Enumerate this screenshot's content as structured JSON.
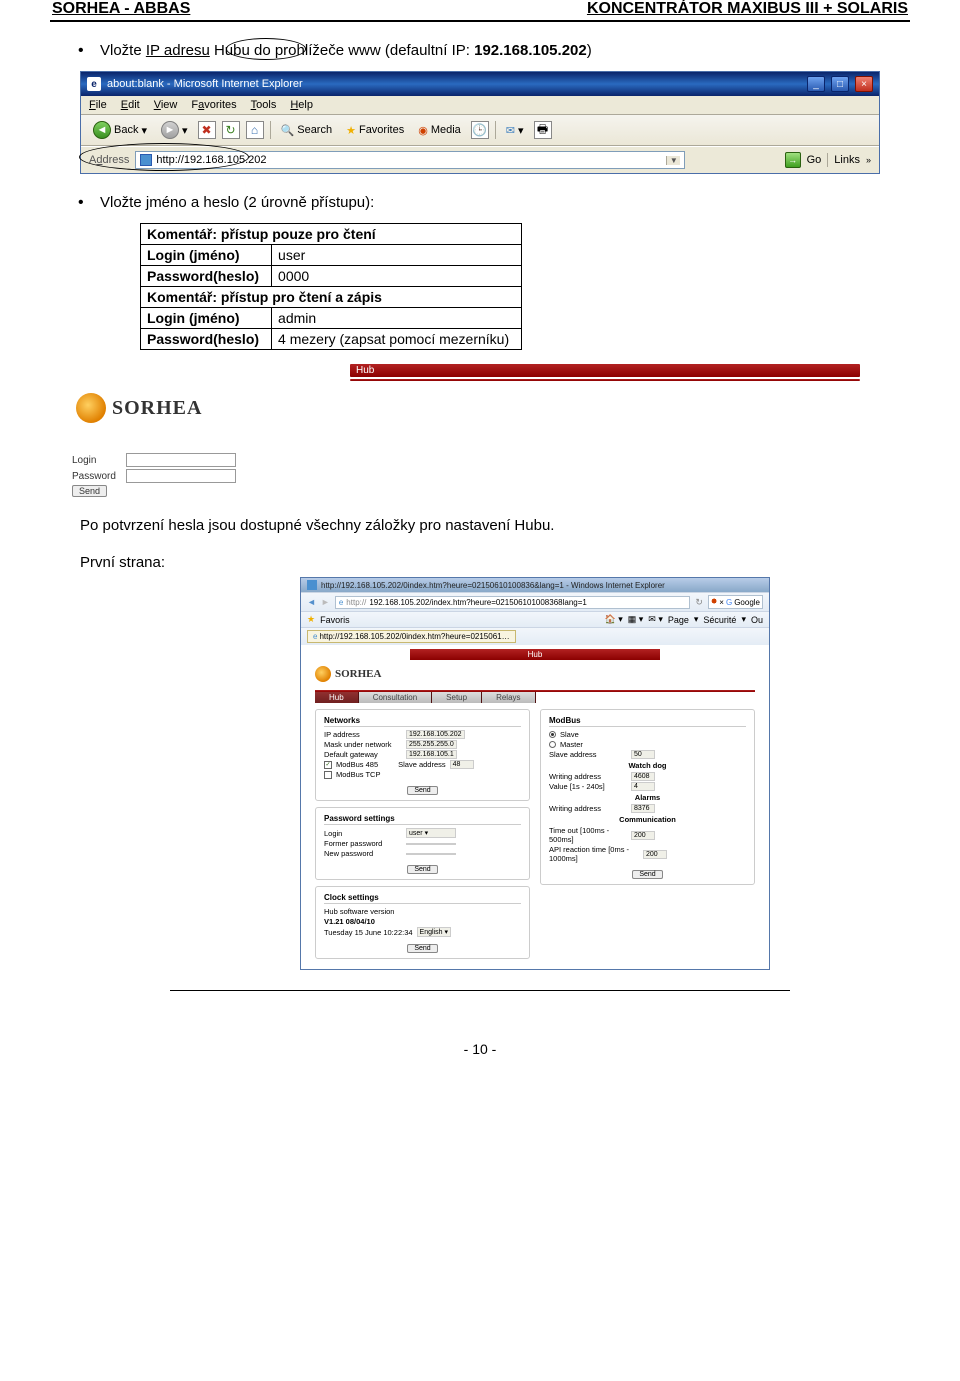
{
  "header": {
    "left": "SORHEA - ABBAS",
    "right": "KONCENTRÁTOR MAXIBUS III + SOLARIS"
  },
  "bullet1": {
    "prefix": "Vložte ",
    "underlined": "IP adresu",
    "suffix": " Hubu do prohlížeče www (defaultní IP: ",
    "ipbold": "192.168.105.202",
    "after": ")"
  },
  "ie": {
    "title": "about:blank - Microsoft Internet Explorer",
    "menu": [
      "File",
      "Edit",
      "View",
      "Favorites",
      "Tools",
      "Help"
    ],
    "tb": {
      "back": "Back",
      "search": "Search",
      "favorites": "Favorites",
      "media": "Media"
    },
    "addr_label": "Address",
    "addr_url": "http://192.168.105.202",
    "go": "Go",
    "links": "Links"
  },
  "bullet2": "Vložte jméno a heslo (2 úrovně přístupu):",
  "table": {
    "r1": "Komentář: přístup pouze pro čtení",
    "r2a": "Login (jméno)",
    "r2b": "user",
    "r3a": "Password(heslo)",
    "r3b": "0000",
    "r4": "Komentář: přístup pro čtení a zápis",
    "r5a": "Login (jméno)",
    "r5b": "admin",
    "r6a": "Password(heslo)",
    "r6b": "4 mezery (zapsat pomocí mezerníku)"
  },
  "login": {
    "hub": "Hub",
    "sorhea": "SORHEA",
    "login_lbl": "Login",
    "password_lbl": "Password",
    "send": "Send"
  },
  "para1": "Po potvrzení hesla jsou dostupné všechny záložky pro nastavení Hubu.",
  "para2": "První strana:",
  "ss": {
    "title": "http://192.168.105.202/0index.htm?heure=02150610100836&lang=1 - Windows Internet Explorer",
    "addr1": "192.168.105.202/index.htm?heure=021506101008368lang=1",
    "addr2": "http://192.168.105.202/0index.htm?heure=0215061…",
    "favoris": "Favoris",
    "google": "Google",
    "page": "Page",
    "securite": "Sécurité",
    "ou": "Ou",
    "tabs": [
      "Hub",
      "Consultation",
      "Setup",
      "Relays"
    ],
    "networks": {
      "title": "Networks",
      "ip_lbl": "IP address",
      "ip": "192.168.105.202",
      "mask_lbl": "Mask under network",
      "mask": "255.255.255.0",
      "gw_lbl": "Default gateway",
      "gw": "192.168.105.1",
      "mb485": "ModBus 485",
      "slaveaddr_lbl": "Slave address",
      "slaveaddr": "48",
      "mbtcp": "ModBus TCP",
      "send": "Send"
    },
    "pwd": {
      "title": "Password settings",
      "login_lbl": "Login",
      "login": "user",
      "former": "Former password",
      "new": "New password",
      "send": "Send"
    },
    "clock": {
      "title": "Clock settings",
      "ver_lbl": "Hub software version",
      "ver": "V1.21 08/04/10",
      "date": "Tuesday 15 June 10:22:34",
      "lang": "English",
      "send": "Send"
    },
    "modbus": {
      "title": "ModBus",
      "slave": "Slave",
      "master": "Master",
      "slaveaddr_lbl": "Slave address",
      "slaveaddr": "50",
      "watchdog": "Watch dog",
      "waddr_lbl": "Writing address",
      "waddr": "4608",
      "val_lbl": "Value [1s - 240s]",
      "val": "4",
      "alarms": "Alarms",
      "waddr2_lbl": "Writing address",
      "waddr2": "8376",
      "comm": "Communication",
      "timeout_lbl": "Time out [100ms - 500ms]",
      "timeout": "200",
      "api_lbl": "API reaction time [0ms - 1000ms]",
      "api": "200",
      "send": "Send"
    }
  },
  "footer": "- 10 -"
}
